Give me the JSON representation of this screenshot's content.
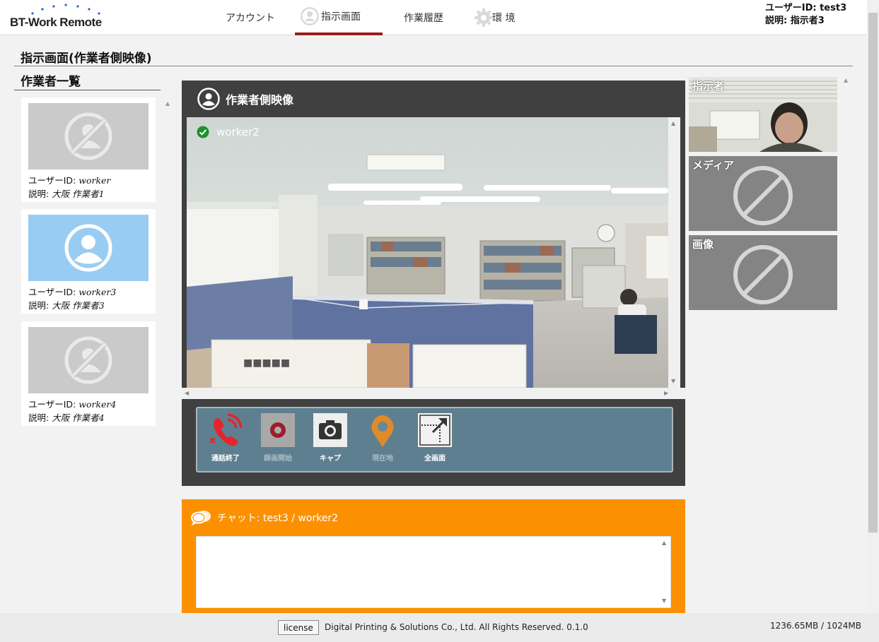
{
  "app": {
    "logo_text": "BT-Work Remote"
  },
  "nav": {
    "items": [
      {
        "label": "アカウント",
        "active": false
      },
      {
        "label": "指示画面",
        "active": true
      },
      {
        "label": "作業履歴",
        "active": false
      },
      {
        "label": "環 境",
        "active": false
      }
    ]
  },
  "user": {
    "id_line": "ユーザーID: test3",
    "desc_line": "説明: 指示者3"
  },
  "page": {
    "title": "指示画面(作業者側映像)"
  },
  "worker_list": {
    "title": "作業者一覧",
    "workers": [
      {
        "id_label": "ユーザーID: ",
        "id": "worker",
        "desc_label": "説明: ",
        "desc": "大阪 作業者1",
        "selected": false,
        "available": false
      },
      {
        "id_label": "ユーザーID: ",
        "id": "worker3",
        "desc_label": "説明: ",
        "desc": "大阪 作業者3",
        "selected": true,
        "available": true
      },
      {
        "id_label": "ユーザーID: ",
        "id": "worker4",
        "desc_label": "説明: ",
        "desc": "大阪 作業者4",
        "selected": false,
        "available": false
      }
    ]
  },
  "video": {
    "title": "作業者側映像",
    "current_worker": "worker2",
    "toolbar": [
      {
        "label": "通話終了",
        "icon": "phone-end-icon",
        "enabled": true
      },
      {
        "label": "録画開始",
        "icon": "record-icon",
        "enabled": false
      },
      {
        "label": "キャプ",
        "icon": "camera-icon",
        "enabled": true
      },
      {
        "label": "現在地",
        "icon": "location-pin-icon",
        "enabled": false
      },
      {
        "label": "全画面",
        "icon": "fullscreen-icon",
        "enabled": true
      }
    ]
  },
  "chat": {
    "title": "チャット: test3 / worker2",
    "message": ""
  },
  "right_panels": [
    {
      "label": "指示者",
      "has_video": true
    },
    {
      "label": "メディア",
      "has_video": false
    },
    {
      "label": "画像",
      "has_video": false
    }
  ],
  "footer": {
    "license_button": "license",
    "copyright": "Digital Printing & Solutions Co., Ltd. All Rights Reserved. 0.1.0",
    "memory": "1236.65MB / 1024MB"
  },
  "colors": {
    "nav_active": "#9b1b1b",
    "video_panel": "#404040",
    "toolbar": "#5e7f90",
    "chat": "#fb9100",
    "selected_worker": "#99ccf2",
    "end_call": "#e3262b"
  }
}
